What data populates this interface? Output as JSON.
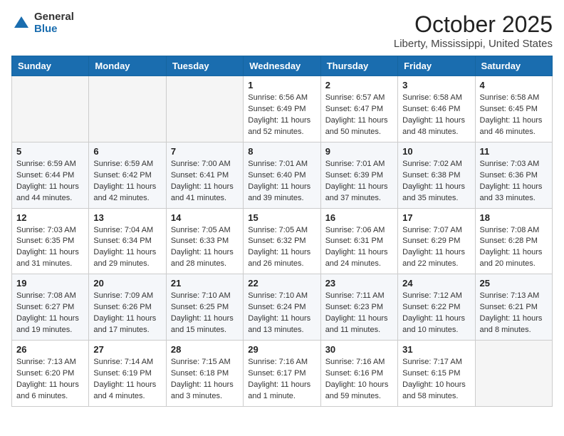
{
  "logo": {
    "general": "General",
    "blue": "Blue"
  },
  "header": {
    "month": "October 2025",
    "location": "Liberty, Mississippi, United States"
  },
  "weekdays": [
    "Sunday",
    "Monday",
    "Tuesday",
    "Wednesday",
    "Thursday",
    "Friday",
    "Saturday"
  ],
  "weeks": [
    [
      {
        "day": "",
        "text": ""
      },
      {
        "day": "",
        "text": ""
      },
      {
        "day": "",
        "text": ""
      },
      {
        "day": "1",
        "text": "Sunrise: 6:56 AM\nSunset: 6:49 PM\nDaylight: 11 hours and 52 minutes."
      },
      {
        "day": "2",
        "text": "Sunrise: 6:57 AM\nSunset: 6:47 PM\nDaylight: 11 hours and 50 minutes."
      },
      {
        "day": "3",
        "text": "Sunrise: 6:58 AM\nSunset: 6:46 PM\nDaylight: 11 hours and 48 minutes."
      },
      {
        "day": "4",
        "text": "Sunrise: 6:58 AM\nSunset: 6:45 PM\nDaylight: 11 hours and 46 minutes."
      }
    ],
    [
      {
        "day": "5",
        "text": "Sunrise: 6:59 AM\nSunset: 6:44 PM\nDaylight: 11 hours and 44 minutes."
      },
      {
        "day": "6",
        "text": "Sunrise: 6:59 AM\nSunset: 6:42 PM\nDaylight: 11 hours and 42 minutes."
      },
      {
        "day": "7",
        "text": "Sunrise: 7:00 AM\nSunset: 6:41 PM\nDaylight: 11 hours and 41 minutes."
      },
      {
        "day": "8",
        "text": "Sunrise: 7:01 AM\nSunset: 6:40 PM\nDaylight: 11 hours and 39 minutes."
      },
      {
        "day": "9",
        "text": "Sunrise: 7:01 AM\nSunset: 6:39 PM\nDaylight: 11 hours and 37 minutes."
      },
      {
        "day": "10",
        "text": "Sunrise: 7:02 AM\nSunset: 6:38 PM\nDaylight: 11 hours and 35 minutes."
      },
      {
        "day": "11",
        "text": "Sunrise: 7:03 AM\nSunset: 6:36 PM\nDaylight: 11 hours and 33 minutes."
      }
    ],
    [
      {
        "day": "12",
        "text": "Sunrise: 7:03 AM\nSunset: 6:35 PM\nDaylight: 11 hours and 31 minutes."
      },
      {
        "day": "13",
        "text": "Sunrise: 7:04 AM\nSunset: 6:34 PM\nDaylight: 11 hours and 29 minutes."
      },
      {
        "day": "14",
        "text": "Sunrise: 7:05 AM\nSunset: 6:33 PM\nDaylight: 11 hours and 28 minutes."
      },
      {
        "day": "15",
        "text": "Sunrise: 7:05 AM\nSunset: 6:32 PM\nDaylight: 11 hours and 26 minutes."
      },
      {
        "day": "16",
        "text": "Sunrise: 7:06 AM\nSunset: 6:31 PM\nDaylight: 11 hours and 24 minutes."
      },
      {
        "day": "17",
        "text": "Sunrise: 7:07 AM\nSunset: 6:29 PM\nDaylight: 11 hours and 22 minutes."
      },
      {
        "day": "18",
        "text": "Sunrise: 7:08 AM\nSunset: 6:28 PM\nDaylight: 11 hours and 20 minutes."
      }
    ],
    [
      {
        "day": "19",
        "text": "Sunrise: 7:08 AM\nSunset: 6:27 PM\nDaylight: 11 hours and 19 minutes."
      },
      {
        "day": "20",
        "text": "Sunrise: 7:09 AM\nSunset: 6:26 PM\nDaylight: 11 hours and 17 minutes."
      },
      {
        "day": "21",
        "text": "Sunrise: 7:10 AM\nSunset: 6:25 PM\nDaylight: 11 hours and 15 minutes."
      },
      {
        "day": "22",
        "text": "Sunrise: 7:10 AM\nSunset: 6:24 PM\nDaylight: 11 hours and 13 minutes."
      },
      {
        "day": "23",
        "text": "Sunrise: 7:11 AM\nSunset: 6:23 PM\nDaylight: 11 hours and 11 minutes."
      },
      {
        "day": "24",
        "text": "Sunrise: 7:12 AM\nSunset: 6:22 PM\nDaylight: 11 hours and 10 minutes."
      },
      {
        "day": "25",
        "text": "Sunrise: 7:13 AM\nSunset: 6:21 PM\nDaylight: 11 hours and 8 minutes."
      }
    ],
    [
      {
        "day": "26",
        "text": "Sunrise: 7:13 AM\nSunset: 6:20 PM\nDaylight: 11 hours and 6 minutes."
      },
      {
        "day": "27",
        "text": "Sunrise: 7:14 AM\nSunset: 6:19 PM\nDaylight: 11 hours and 4 minutes."
      },
      {
        "day": "28",
        "text": "Sunrise: 7:15 AM\nSunset: 6:18 PM\nDaylight: 11 hours and 3 minutes."
      },
      {
        "day": "29",
        "text": "Sunrise: 7:16 AM\nSunset: 6:17 PM\nDaylight: 11 hours and 1 minute."
      },
      {
        "day": "30",
        "text": "Sunrise: 7:16 AM\nSunset: 6:16 PM\nDaylight: 10 hours and 59 minutes."
      },
      {
        "day": "31",
        "text": "Sunrise: 7:17 AM\nSunset: 6:15 PM\nDaylight: 10 hours and 58 minutes."
      },
      {
        "day": "",
        "text": ""
      }
    ]
  ]
}
